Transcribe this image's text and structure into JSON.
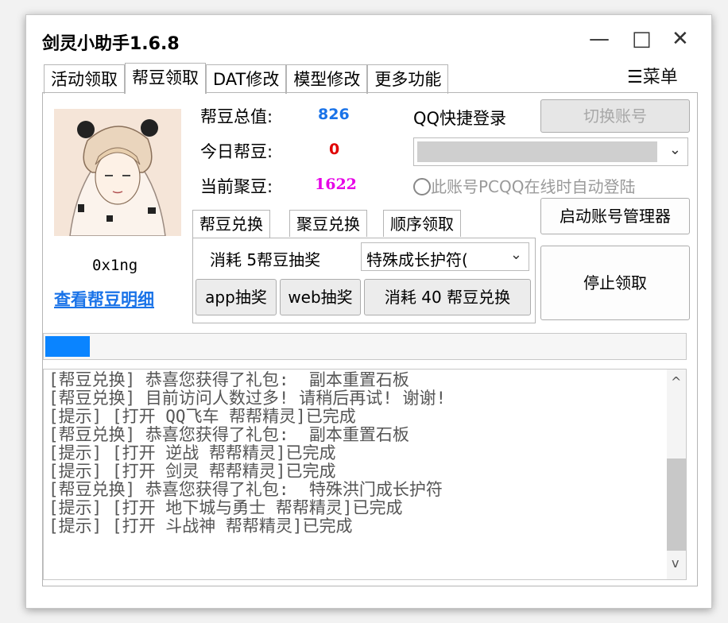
{
  "window": {
    "title": "剑灵小助手1.6.8",
    "minimize": "—",
    "maximize": "□",
    "close": "✕"
  },
  "menu": {
    "icon": "hamburger-icon",
    "label": "菜单"
  },
  "tabs": [
    {
      "label": "活动领取",
      "active": false
    },
    {
      "label": "帮豆领取",
      "active": true
    },
    {
      "label": "DAT修改",
      "active": false
    },
    {
      "label": "模型修改",
      "active": false
    },
    {
      "label": "更多功能",
      "active": false
    }
  ],
  "profile": {
    "name": "0x1ng",
    "details_link": "查看帮豆明细"
  },
  "stats": {
    "total_label": "帮豆总值:",
    "total_value": "826",
    "today_label": "今日帮豆:",
    "today_value": "0",
    "current_label": "当前聚豆:",
    "current_value": "1622"
  },
  "colors": {
    "total": "#1a73e8",
    "today": "#e00000",
    "current": "#e600e6",
    "progress": "#0a84ff"
  },
  "qq": {
    "label": "QQ快捷登录",
    "switch_button": "切换账号",
    "account_select": "",
    "auto_login": "此账号PCQQ在线时自动登陆",
    "manager_button": "启动账号管理器",
    "stop_button": "停止领取"
  },
  "subtabs": [
    {
      "label": "帮豆兑换",
      "active": true
    },
    {
      "label": "聚豆兑换",
      "active": false
    },
    {
      "label": "顺序领取",
      "active": false
    }
  ],
  "exchange": {
    "cost_label": "消耗 5帮豆抽奖",
    "item_select": "特殊成长护符(",
    "app_button": "app抽奖",
    "web_button": "web抽奖",
    "exchange_button": "消耗 40 帮豆兑换"
  },
  "progress": {
    "value": 0.07
  },
  "log": {
    "lines": [
      "[帮豆兑换] 恭喜您获得了礼包:  副本重置石板",
      "[帮豆兑换] 目前访问人数过多! 请稍后再试! 谢谢!",
      "[提示] [打开 QQ飞车 帮帮精灵]已完成",
      "[帮豆兑换] 恭喜您获得了礼包:  副本重置石板",
      "[提示] [打开 逆战 帮帮精灵]已完成",
      "[提示] [打开 剑灵 帮帮精灵]已完成",
      "[帮豆兑换] 恭喜您获得了礼包:  特殊洪门成长护符",
      "[提示] [打开 地下城与勇士 帮帮精灵]已完成",
      "[提示] [打开 斗战神 帮帮精灵]已完成"
    ],
    "scroll_up": "^",
    "scroll_down": "v"
  }
}
